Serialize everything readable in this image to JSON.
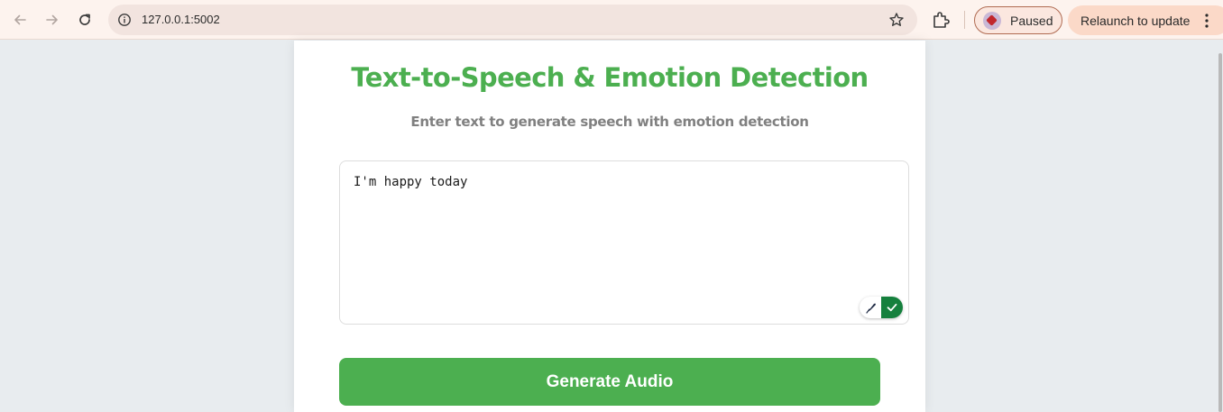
{
  "browser": {
    "url": "127.0.0.1:5002",
    "profile_status": "Paused",
    "relaunch_label": "Relaunch to update",
    "icons": [
      "back-arrow-icon",
      "forward-arrow-icon",
      "reload-icon",
      "info-icon",
      "bookmark-star-icon",
      "extensions-icon",
      "more-menu-icon"
    ]
  },
  "page": {
    "title": "Text-to-Speech & Emotion Detection",
    "subtitle": "Enter text to generate speech with emotion detection",
    "input_text": "I'm happy today",
    "generate_label": "Generate Audio",
    "accent_color": "#4caf50"
  }
}
